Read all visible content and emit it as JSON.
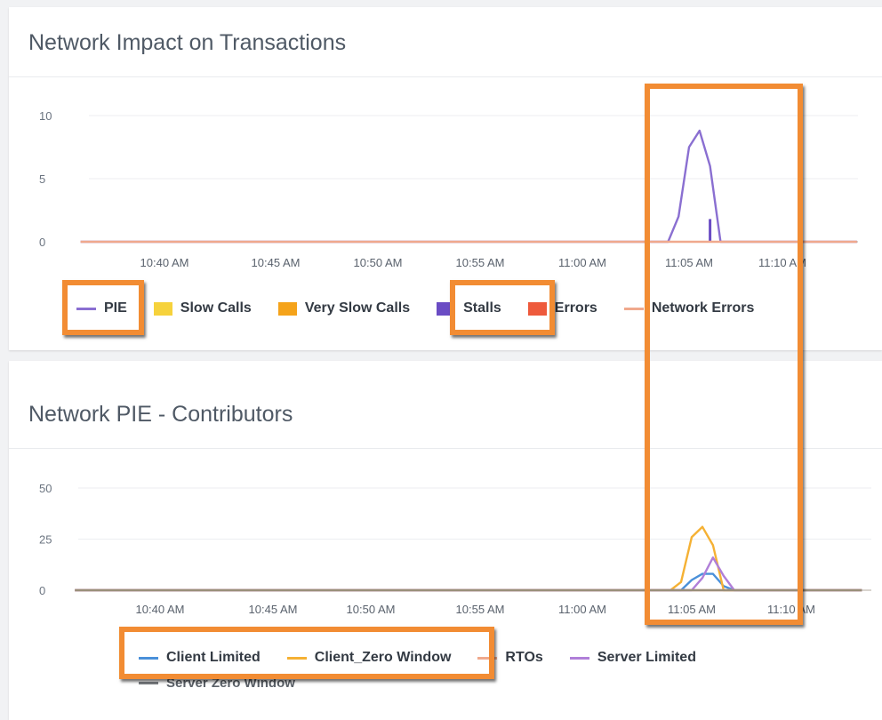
{
  "panels": [
    {
      "title": "Network Impact on Transactions"
    },
    {
      "title": "Network PIE - Contributors"
    }
  ],
  "chart_data": [
    {
      "type": "line",
      "title": "Network Impact on Transactions",
      "x": [
        "10:36 AM",
        "10:38 AM",
        "10:40 AM",
        "10:42 AM",
        "10:44 AM",
        "10:46 AM",
        "10:48 AM",
        "10:50 AM",
        "10:52 AM",
        "10:54 AM",
        "10:56 AM",
        "10:58 AM",
        "11:00 AM",
        "11:02 AM",
        "11:04 AM",
        "11:04:30 AM",
        "11:05 AM",
        "11:05:30 AM",
        "11:06 AM",
        "11:06:30 AM",
        "11:07 AM",
        "11:08 AM",
        "11:10 AM",
        "11:12 AM",
        "11:13 AM"
      ],
      "x_tick_labels": [
        "10:40 AM",
        "10:45 AM",
        "10:50 AM",
        "10:55 AM",
        "11:00 AM",
        "11:05 AM",
        "11:10 AM"
      ],
      "y_ticks": [
        0,
        5,
        10
      ],
      "ylim": [
        0,
        11
      ],
      "grid": true,
      "legend_position": "bottom",
      "series": [
        {
          "name": "PIE",
          "kind": "line",
          "color": "#8a6fd1",
          "values": [
            0,
            0,
            0,
            0,
            0,
            0,
            0,
            0,
            0,
            0,
            0,
            0,
            0,
            0,
            0,
            2,
            7.5,
            8.8,
            6,
            0,
            0,
            0,
            0,
            0,
            0
          ]
        },
        {
          "name": "Slow Calls",
          "kind": "box",
          "color": "#f6d23c",
          "values": [
            0,
            0,
            0,
            0,
            0,
            0,
            0,
            0,
            0,
            0,
            0,
            0,
            0,
            0,
            0,
            0,
            0,
            0,
            0,
            0,
            0,
            0,
            0,
            0,
            0
          ]
        },
        {
          "name": "Very Slow Calls",
          "kind": "box",
          "color": "#f5a31a",
          "values": [
            0,
            0,
            0,
            0,
            0,
            0,
            0,
            0,
            0,
            0,
            0,
            0,
            0,
            0,
            0,
            0,
            0,
            0,
            0,
            0,
            0,
            0,
            0,
            0,
            0
          ]
        },
        {
          "name": "Stalls",
          "kind": "box",
          "color": "#6a4cc4",
          "values": [
            0,
            0,
            0,
            0,
            0,
            0,
            0,
            0,
            0,
            0,
            0,
            0,
            0,
            0,
            0,
            0,
            0,
            0,
            1.8,
            0,
            0,
            0,
            0,
            0,
            0
          ]
        },
        {
          "name": "Errors",
          "kind": "box",
          "color": "#ee5a3c",
          "values": [
            0,
            0,
            0,
            0,
            0,
            0,
            0,
            0,
            0,
            0,
            0,
            0,
            0,
            0,
            0,
            0,
            0,
            0,
            0,
            0,
            0,
            0,
            0,
            0,
            0
          ]
        },
        {
          "name": "Network Errors",
          "kind": "line",
          "color": "#f0a98d",
          "values": [
            0,
            0,
            0,
            0,
            0,
            0,
            0,
            0,
            0,
            0,
            0,
            0,
            0,
            0,
            0,
            0,
            0,
            0,
            0,
            0,
            0,
            0,
            0,
            0,
            0
          ]
        }
      ]
    },
    {
      "type": "line",
      "title": "Network PIE - Contributors",
      "x": [
        "10:36 AM",
        "10:38 AM",
        "10:40 AM",
        "10:42 AM",
        "10:44 AM",
        "10:46 AM",
        "10:48 AM",
        "10:50 AM",
        "10:52 AM",
        "10:54 AM",
        "10:56 AM",
        "10:58 AM",
        "11:00 AM",
        "11:02 AM",
        "11:04 AM",
        "11:04:30 AM",
        "11:05 AM",
        "11:05:30 AM",
        "11:06 AM",
        "11:06:30 AM",
        "11:07 AM",
        "11:08 AM",
        "11:10 AM",
        "11:12 AM",
        "11:13 AM"
      ],
      "x_tick_labels": [
        "10:40 AM",
        "10:45 AM",
        "10:50 AM",
        "10:55 AM",
        "11:00 AM",
        "11:05 AM",
        "11:10 AM"
      ],
      "y_ticks": [
        0,
        25,
        50
      ],
      "ylim": [
        0,
        55
      ],
      "grid": true,
      "legend_position": "bottom",
      "series": [
        {
          "name": "Client Limited",
          "kind": "line",
          "color": "#4a90d9",
          "values": [
            0,
            0,
            0,
            0,
            0,
            0,
            0,
            0,
            0,
            0,
            0,
            0,
            0,
            0,
            0,
            0,
            5,
            8,
            8,
            2,
            0,
            0,
            0,
            0,
            0
          ]
        },
        {
          "name": "Client_Zero Window",
          "kind": "line",
          "color": "#f5b134",
          "values": [
            0,
            0,
            0,
            0,
            0,
            0,
            0,
            0,
            0,
            0,
            0,
            0,
            0,
            0,
            0,
            4,
            26,
            31,
            22,
            0,
            0,
            0,
            0,
            0,
            0
          ]
        },
        {
          "name": "RTOs",
          "kind": "line",
          "color": "#f0a98d",
          "values": [
            0,
            0,
            0,
            0,
            0,
            0,
            0,
            0,
            0,
            0,
            0,
            0,
            0,
            0,
            0,
            0,
            0,
            0,
            0,
            0,
            0,
            0,
            0,
            0,
            0
          ]
        },
        {
          "name": "Server Limited",
          "kind": "line",
          "color": "#b07fd8",
          "values": [
            0,
            0,
            0,
            0,
            0,
            0,
            0,
            0,
            0,
            0,
            0,
            0,
            0,
            0,
            0,
            0,
            0,
            6,
            16,
            7,
            0,
            0,
            0,
            0,
            0
          ]
        },
        {
          "name": "Server Zero Window",
          "kind": "line",
          "color": "#9a8f7a",
          "values": [
            0,
            0,
            0,
            0,
            0,
            0,
            0,
            0,
            0,
            0,
            0,
            0,
            0,
            0,
            0,
            0,
            0,
            0,
            0,
            0,
            0,
            0,
            0,
            0,
            0
          ]
        }
      ]
    }
  ]
}
